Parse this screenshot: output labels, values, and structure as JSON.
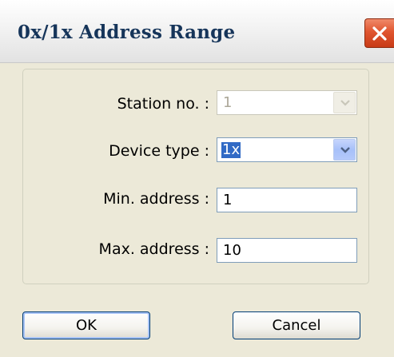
{
  "window": {
    "title": "0x/1x Address Range"
  },
  "fields": {
    "station": {
      "label": "Station no. :",
      "value": "1",
      "disabled": true
    },
    "device_type": {
      "label": "Device type :",
      "value": "1x"
    },
    "min_address": {
      "label": "Min. address :",
      "value": "1"
    },
    "max_address": {
      "label": "Max. address :",
      "value": "10"
    }
  },
  "buttons": {
    "ok": "OK",
    "cancel": "Cancel"
  },
  "icons": {
    "close": "close-icon",
    "dropdown": "chevron-down-icon"
  },
  "colors": {
    "window_bg": "#ece9d8",
    "title_text": "#16355a",
    "close_button": "#e0552f",
    "selection": "#316ac5",
    "input_border": "#7f9db9"
  }
}
